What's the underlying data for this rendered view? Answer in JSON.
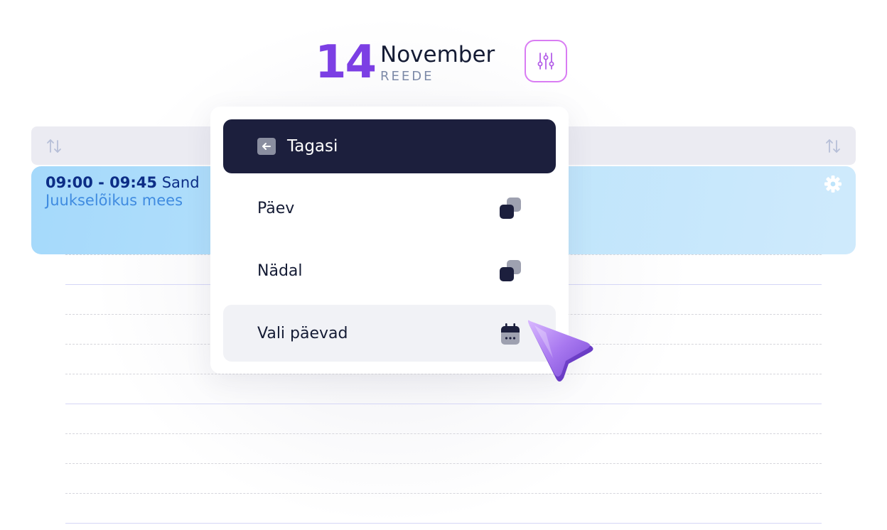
{
  "header": {
    "day_number": "14",
    "month": "November",
    "weekday": "REEDE",
    "filter_icon": "sliders-icon",
    "accent_color": "#7c3fe4"
  },
  "calendar": {
    "sort_icon": "sort-arrows-icon",
    "event": {
      "time_range": "09:00 - 09:45",
      "client": "Sand",
      "service": "Juukselõikus mees",
      "settings_icon": "gear-icon",
      "color": "#a5d9fb"
    }
  },
  "menu": {
    "back": {
      "label": "Tagasi",
      "icon": "arrow-left-icon"
    },
    "items": [
      {
        "label": "Päev",
        "icon": "squares-icon"
      },
      {
        "label": "Nädal",
        "icon": "squares-icon"
      },
      {
        "label": "Vali päevad",
        "icon": "calendar-icon"
      }
    ]
  }
}
